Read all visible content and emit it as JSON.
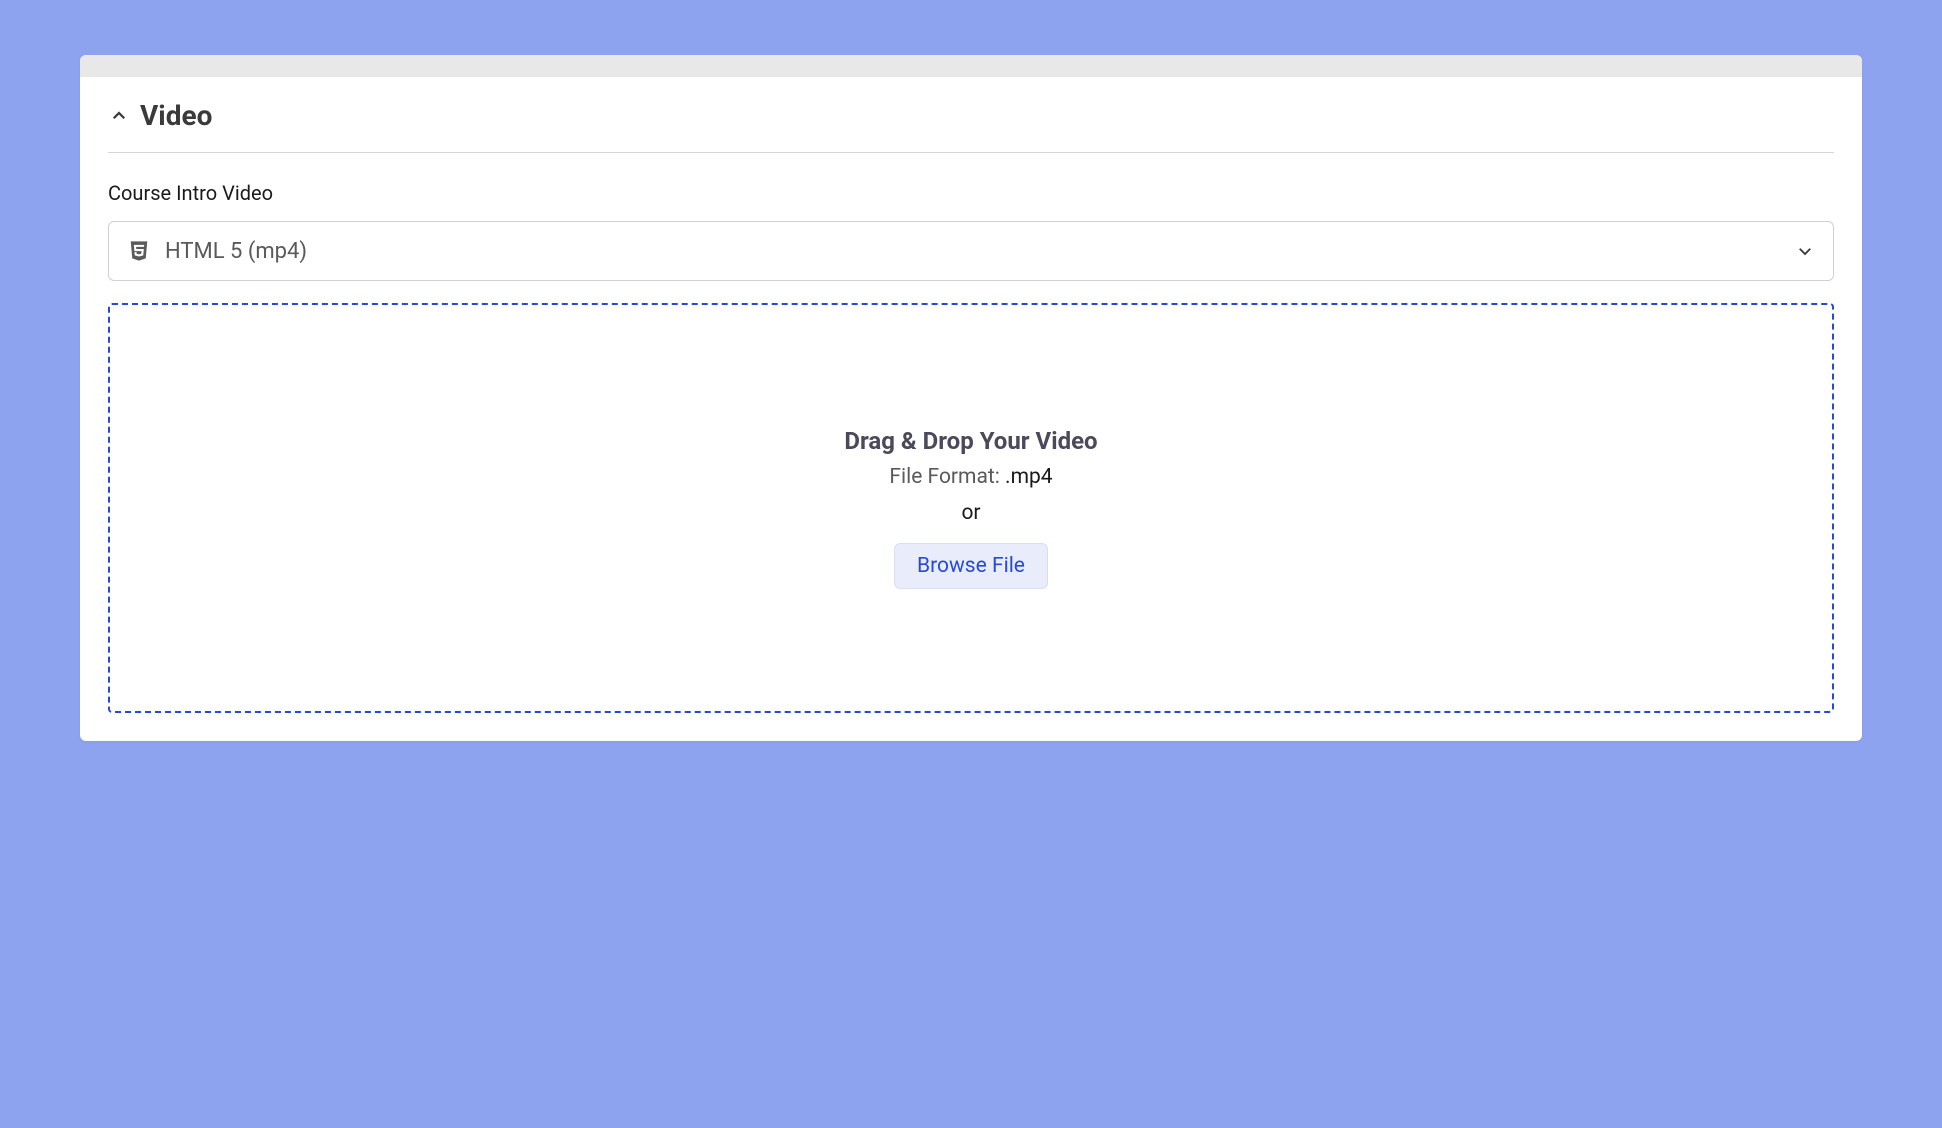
{
  "section": {
    "title": "Video"
  },
  "field": {
    "label": "Course Intro Video"
  },
  "select": {
    "value": "HTML 5 (mp4)"
  },
  "dropzone": {
    "title": "Drag & Drop Your Video",
    "format_label": "File Format: ",
    "format_ext": ".mp4",
    "or_text": "or",
    "browse_label": "Browse File"
  }
}
